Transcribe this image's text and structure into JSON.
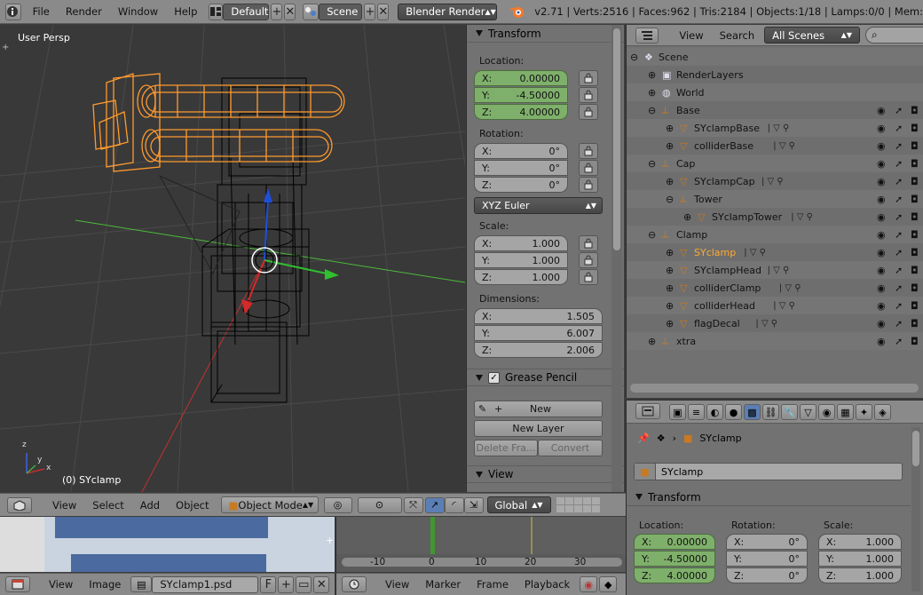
{
  "topbar": {
    "menus": [
      "File",
      "Render",
      "Window",
      "Help"
    ],
    "screen_layout": "Default",
    "scene": "Scene",
    "engine": "Blender Render",
    "stats": "v2.71 | Verts:2516 | Faces:962 | Tris:2184 | Objects:1/18 | Lamps:0/0 | Mem:"
  },
  "viewport": {
    "view_label": "User Persp",
    "object_label": "(0) SYclamp",
    "axis_x": "x",
    "axis_y": "y",
    "axis_z": "z"
  },
  "npanel": {
    "transform_title": "Transform",
    "location_label": "Location:",
    "location": {
      "x_label": "X:",
      "x": "0.00000",
      "y_label": "Y:",
      "y": "-4.50000",
      "z_label": "Z:",
      "z": "4.00000"
    },
    "rotation_label": "Rotation:",
    "rotation": {
      "x_label": "X:",
      "x": "0°",
      "y_label": "Y:",
      "y": "0°",
      "z_label": "Z:",
      "z": "0°"
    },
    "rotation_mode": "XYZ Euler",
    "scale_label": "Scale:",
    "scale": {
      "x_label": "X:",
      "x": "1.000",
      "y_label": "Y:",
      "y": "1.000",
      "z_label": "Z:",
      "z": "1.000"
    },
    "dimensions_label": "Dimensions:",
    "dimensions": {
      "x_label": "X:",
      "x": "1.505",
      "y_label": "Y:",
      "y": "6.007",
      "z_label": "Z:",
      "z": "2.006"
    },
    "grease_title": "Grease Pencil",
    "new_label": "New",
    "new_layer_label": "New Layer",
    "delete_frame_label": "Delete Fra...",
    "convert_label": "Convert",
    "view_title": "View"
  },
  "outliner": {
    "view_menu": "View",
    "search_menu": "Search",
    "filter": "All Scenes",
    "rows": [
      {
        "name": "Scene",
        "indent": 0
      },
      {
        "name": "RenderLayers",
        "indent": 1
      },
      {
        "name": "World",
        "indent": 1
      },
      {
        "name": "Base",
        "indent": 1
      },
      {
        "name": "SYclampBase",
        "indent": 2
      },
      {
        "name": "colliderBase",
        "indent": 2
      },
      {
        "name": "Cap",
        "indent": 1
      },
      {
        "name": "SYclampCap",
        "indent": 2
      },
      {
        "name": "Tower",
        "indent": 2
      },
      {
        "name": "SYclampTower",
        "indent": 3
      },
      {
        "name": "Clamp",
        "indent": 1
      },
      {
        "name": "SYclamp",
        "indent": 2
      },
      {
        "name": "SYclampHead",
        "indent": 2
      },
      {
        "name": "colliderClamp",
        "indent": 2
      },
      {
        "name": "colliderHead",
        "indent": 2
      },
      {
        "name": "flagDecal",
        "indent": 2
      },
      {
        "name": "xtra",
        "indent": 1
      }
    ]
  },
  "props": {
    "breadcrumb_object": "SYclamp",
    "object_name": "SYclamp",
    "transform_title": "Transform",
    "location_label": "Location:",
    "rotation_label": "Rotation:",
    "scale_label": "Scale:",
    "loc": {
      "x_label": "X:",
      "x": "0.00000",
      "y_label": "Y:",
      "y": "-4.50000",
      "z_label": "Z:",
      "z": "4.00000"
    },
    "rot": {
      "x_label": "X:",
      "x": "0°",
      "y_label": "Y:",
      "y": "0°",
      "z_label": "Z:",
      "z": "0°"
    },
    "scl": {
      "x_label": "X:",
      "x": "1.000",
      "y_label": "Y:",
      "y": "1.000",
      "z_label": "Z:",
      "z": "1.000"
    }
  },
  "vp_header": {
    "view": "View",
    "select": "Select",
    "add": "Add",
    "object": "Object",
    "mode": "Object Mode",
    "orientation": "Global"
  },
  "image_editor": {
    "view": "View",
    "image": "Image",
    "image_name": "SYclamp1.psd",
    "fake_user": "F"
  },
  "timeline": {
    "ticks": [
      "-10",
      "0",
      "10",
      "20",
      "30"
    ],
    "view": "View",
    "marker": "Marker",
    "frame": "Frame",
    "playback": "Playback"
  },
  "colors": {
    "selection_orange": "#ff9a2e",
    "active_green": "#7fb06b",
    "grid_line": "#4a4a4a"
  }
}
